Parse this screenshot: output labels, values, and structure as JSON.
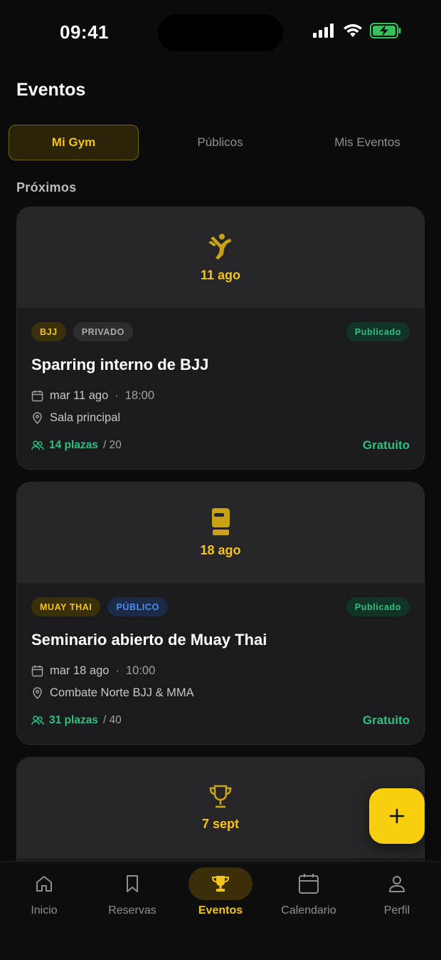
{
  "status_bar": {
    "time": "09:41"
  },
  "header": {
    "title": "Eventos"
  },
  "tabs": [
    {
      "label": "Mi Gym",
      "active": true
    },
    {
      "label": "Públicos",
      "active": false
    },
    {
      "label": "Mis Eventos",
      "active": false
    }
  ],
  "section": {
    "label": "Próximos"
  },
  "events": [
    {
      "icon": "martial-arts-kick-icon",
      "date": "11 ago",
      "sport_badge": "BJJ",
      "visibility_badge": "PRIVADO",
      "status": "Publicado",
      "title": "Sparring interno de BJJ",
      "datetime": "mar 11 ago",
      "time": "18:00",
      "location": "Sala principal",
      "spots": "14 plazas",
      "capacity": "/ 20",
      "price": "Gratuito"
    },
    {
      "icon": "boxing-glove-icon",
      "date": "18 ago",
      "sport_badge": "MUAY THAI",
      "visibility_badge": "PÚBLICO",
      "status": "Publicado",
      "title": "Seminario abierto de Muay Thai",
      "datetime": "mar 18 ago",
      "time": "10:00",
      "location": "Combate Norte BJJ & MMA",
      "spots": "31 plazas",
      "capacity": "/ 40",
      "price": "Gratuito"
    },
    {
      "icon": "trophy-icon",
      "date": "7 sept"
    }
  ],
  "fab": {
    "icon": "plus-icon"
  },
  "bottom_nav": [
    {
      "label": "Inicio",
      "icon": "home-icon",
      "active": false
    },
    {
      "label": "Reservas",
      "icon": "bookmark-icon",
      "active": false
    },
    {
      "label": "Eventos",
      "icon": "trophy-icon",
      "active": true
    },
    {
      "label": "Calendario",
      "icon": "calendar-icon",
      "active": false
    },
    {
      "label": "Perfil",
      "icon": "user-icon",
      "active": false
    }
  ],
  "colors": {
    "accent": "#f4c518",
    "success": "#2fbf83",
    "public_badge": "#4d8df5",
    "background": "#0b0b0c",
    "card": "#1b1b1d"
  }
}
